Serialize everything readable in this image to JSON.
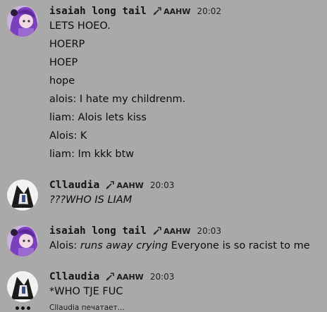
{
  "messages": [
    {
      "username": "isaiah long tail",
      "tag": "AAHW",
      "time": "20:02",
      "lines": [
        "LETS HOEO.",
        "HOERP",
        "HOEP",
        "hope",
        "alois: I hate my childrenm.",
        "liam: Alois lets kiss",
        "Alois: K",
        "liam: Im kkk btw"
      ]
    },
    {
      "username": "Cllaudia",
      "tag": "AAHW",
      "time": "20:03",
      "lines": [
        "???WHO IS LIAM"
      ]
    },
    {
      "username": "isaiah long tail",
      "tag": "AAHW",
      "time": "20:03",
      "line_parts": [
        "Alois: ",
        "runs away crying",
        " Everyone is so racist to me"
      ]
    },
    {
      "username": "Cllaudia",
      "tag": "AAHW",
      "time": "20:03",
      "lines": [
        "*WHO TJE FUC"
      ]
    }
  ],
  "typing_indicator": "Cllaudia печатает...",
  "colors": {
    "background": "#a9a9a9",
    "avatar_purple": "#8a4fc4",
    "text": "#0a0a0a"
  },
  "icons": [
    "sword-tag-icon",
    "typing-dots-icon"
  ]
}
